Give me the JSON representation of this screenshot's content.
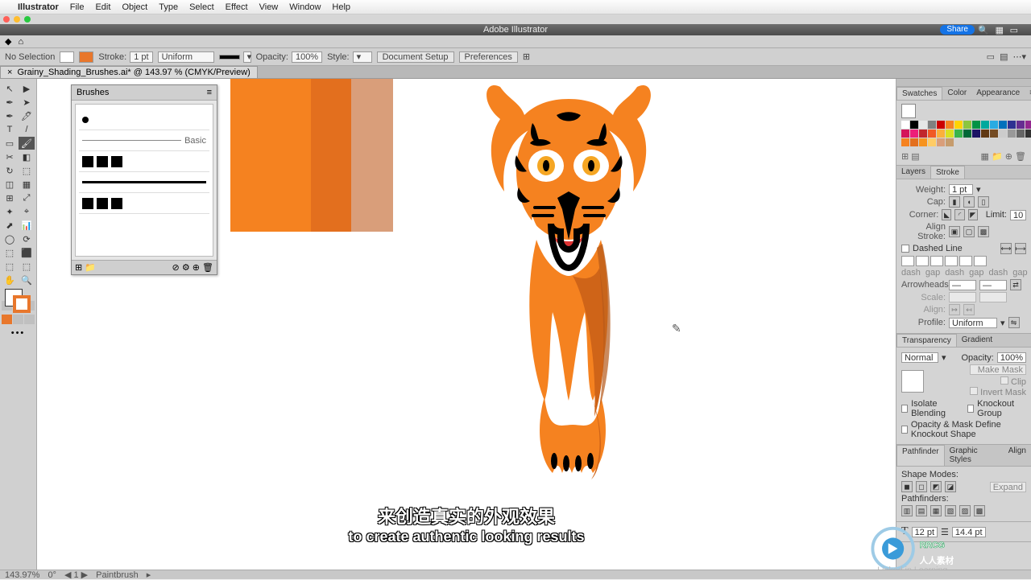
{
  "menu": {
    "apple": "",
    "app": "Illustrator",
    "items": [
      "File",
      "Edit",
      "Object",
      "Type",
      "Select",
      "Effect",
      "View",
      "Window",
      "Help"
    ]
  },
  "window": {
    "title": "Adobe Illustrator",
    "share": "Share"
  },
  "control": {
    "no_selection": "No Selection",
    "stroke_label": "Stroke:",
    "stroke_val": "1 pt",
    "uniform": "Uniform",
    "opacity_label": "Opacity:",
    "opacity_val": "100%",
    "style_label": "Style:",
    "doc_setup": "Document Setup",
    "prefs": "Preferences"
  },
  "doc_tab": {
    "close": "×",
    "name": "Grainy_Shading_Brushes.ai* @ 143.97 % (CMYK/Preview)"
  },
  "brushes": {
    "title": "Brushes",
    "basic": "Basic"
  },
  "right": {
    "swatches_tabs": [
      "Swatches",
      "Color",
      "Appearance"
    ],
    "ls_tabs": [
      "Layers",
      "Stroke"
    ],
    "weight_lbl": "Weight:",
    "weight_val": "1 pt",
    "cap_lbl": "Cap:",
    "corner_lbl": "Corner:",
    "limit_lbl": "Limit:",
    "limit_val": "10",
    "align_stroke_lbl": "Align Stroke:",
    "dashed": "Dashed Line",
    "dash_labels": [
      "dash",
      "gap",
      "dash",
      "gap",
      "dash",
      "gap"
    ],
    "arrow_lbl": "Arrowheads:",
    "scale_lbl": "Scale:",
    "align_lbl": "Align:",
    "profile_lbl": "Profile:",
    "profile_val": "Uniform",
    "tg_tabs": [
      "Transparency",
      "Gradient"
    ],
    "blend_val": "Normal",
    "tr_opacity_lbl": "Opacity:",
    "tr_opacity_val": "100%",
    "make_mask": "Make Mask",
    "clip": "Clip",
    "invert": "Invert Mask",
    "iso": "Isolate Blending",
    "knock": "Knockout Group",
    "mask_def": "Opacity & Mask Define Knockout Shape",
    "pf_tabs": [
      "Pathfinder",
      "Graphic Styles",
      "Align"
    ],
    "shape_modes": "Shape Modes:",
    "expand": "Expand",
    "pathfinders": "Pathfinders:",
    "char_size": "12 pt",
    "char_lead": "14.4 pt"
  },
  "swatch_colors": [
    "#ffffff",
    "#000000",
    "#e6e6e6",
    "#808080",
    "#c00",
    "#f58220",
    "#ffd400",
    "#8cc63f",
    "#009245",
    "#00a99d",
    "#29abe2",
    "#0071bc",
    "#2e3192",
    "#662d91",
    "#93278f",
    "#d4145a",
    "#ed1e79",
    "#c1272d",
    "#f15a24",
    "#fbb03b",
    "#d9e021",
    "#39b54a",
    "#006837",
    "#1b1464",
    "#603813",
    "#754c24",
    "#ccc",
    "#999",
    "#666",
    "#333",
    "#f58220",
    "#e36f1e",
    "#f7931e",
    "#ffcc66",
    "#d99e7a",
    "#c69c6d"
  ],
  "status": {
    "zoom": "143.97%",
    "rot": "0°",
    "page": "1",
    "tool": "Paintbrush"
  },
  "subs": {
    "l1": "来创造真实的外观效果",
    "l2": "to create authentic looking results"
  },
  "watermark": {
    "brand": "RRCG",
    "sub": "人人素材",
    "li": "Linked in Learning"
  },
  "tools": [
    "↖",
    "▶",
    "✒",
    "➤",
    "✒",
    "🖊",
    "T",
    "/",
    "▭",
    "🖌",
    "✂",
    "◧",
    "↻",
    "⬚",
    "◫",
    "▦",
    "⊞",
    "⤢",
    "✦",
    "⌖",
    "⬈",
    "📊",
    "◯",
    "⟳",
    "⬚",
    "⬛",
    "⬚",
    "⬚",
    "✋",
    "🔍"
  ]
}
